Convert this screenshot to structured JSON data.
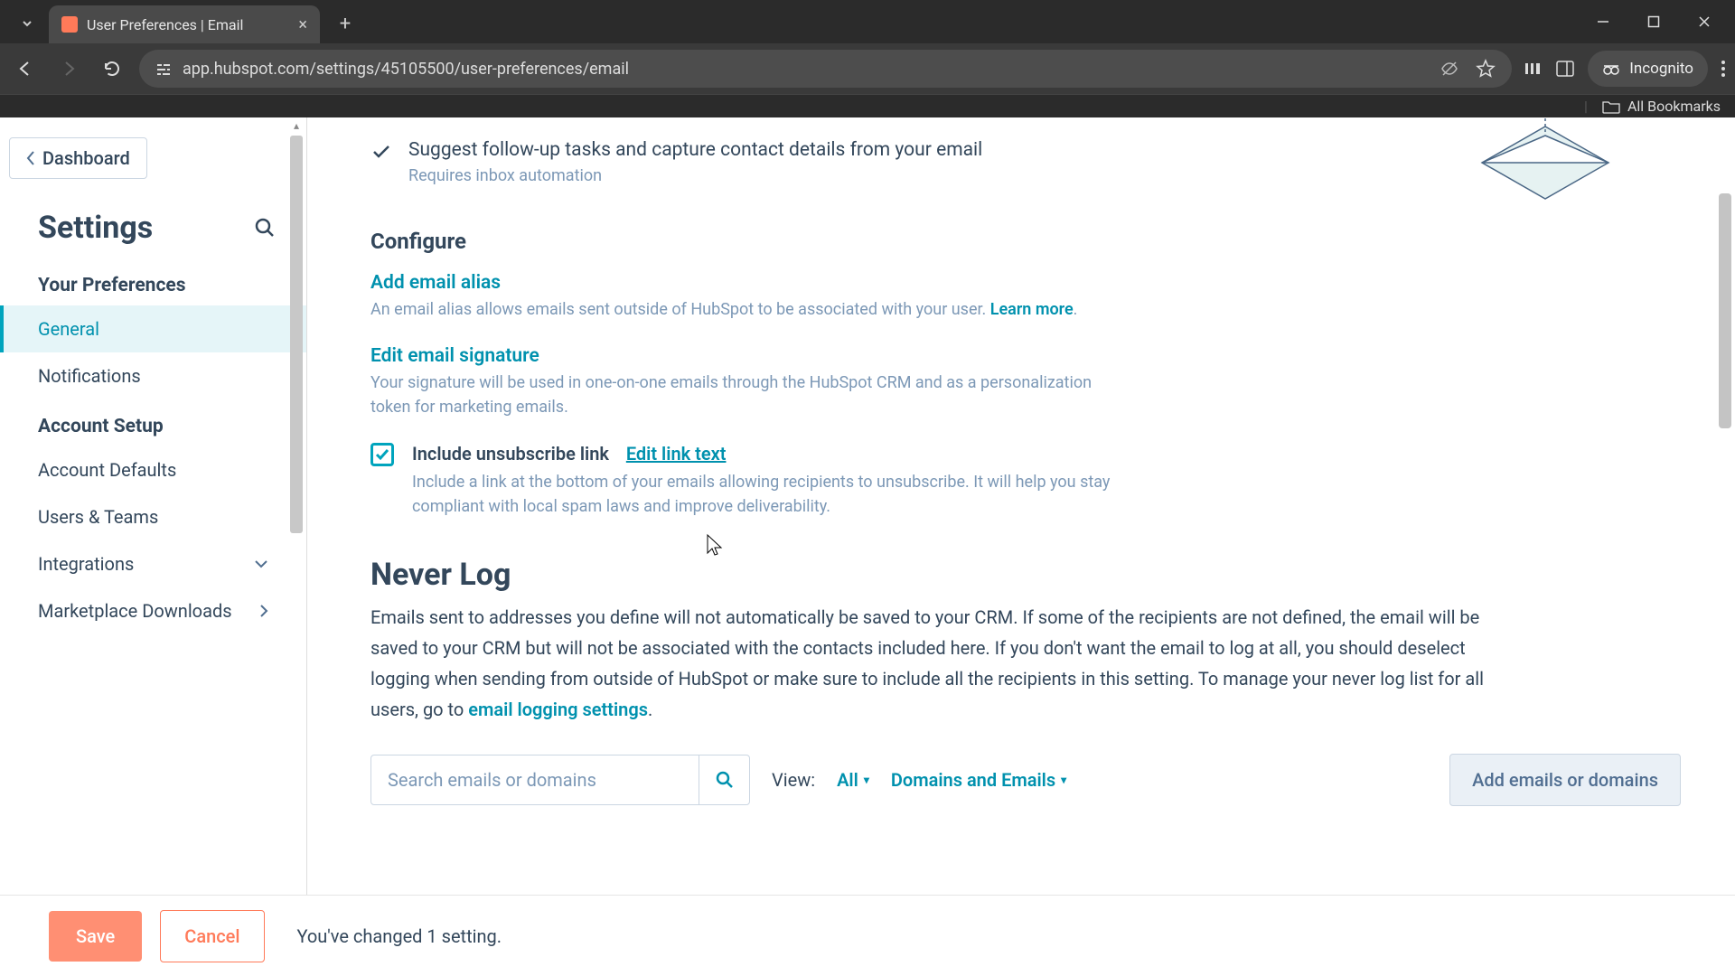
{
  "browser": {
    "tab_title": "User Preferences | Email",
    "url": "app.hubspot.com/settings/45105500/user-preferences/email",
    "incognito_label": "Incognito",
    "all_bookmarks": "All Bookmarks"
  },
  "sidebar": {
    "back_label": "Dashboard",
    "title": "Settings",
    "sections": [
      {
        "title": "Your Preferences",
        "items": [
          {
            "label": "General",
            "active": true
          },
          {
            "label": "Notifications"
          }
        ]
      },
      {
        "title": "Account Setup",
        "items": [
          {
            "label": "Account Defaults"
          },
          {
            "label": "Users & Teams"
          },
          {
            "label": "Integrations",
            "expandable": true
          },
          {
            "label": "Marketplace Downloads",
            "expandable": true
          }
        ]
      }
    ]
  },
  "content": {
    "feature": {
      "text": "Suggest follow-up tasks and capture contact details from your email",
      "sub": "Requires inbox automation"
    },
    "configure_heading": "Configure",
    "alias": {
      "link": "Add email alias",
      "desc_a": "An email alias allows emails sent outside of HubSpot to be associated with your user. ",
      "learn_more": "Learn more"
    },
    "signature": {
      "link": "Edit email signature",
      "desc": "Your signature will be used in one-on-one emails through the HubSpot CRM and as a personalization token for marketing emails."
    },
    "unsubscribe": {
      "label": "Include unsubscribe link",
      "edit_link": "Edit link text",
      "desc": "Include a link at the bottom of your emails allowing recipients to unsubscribe. It will help you stay compliant with local spam laws and improve deliverability."
    },
    "never_log": {
      "heading": "Never Log",
      "desc_a": "Emails sent to addresses you define will not automatically be saved to your CRM. If some of the recipients are not defined, the email will be saved to your CRM but will not be associated with the contacts included here. If you don't want the email to log at all, you should deselect logging when sending from outside of HubSpot or make sure to include all the recipients in this setting. To manage your never log list for all users, go to ",
      "link": "email logging settings",
      "period": "."
    },
    "search": {
      "placeholder": "Search emails or domains"
    },
    "view_label": "View:",
    "view_all": "All",
    "view_de": "Domains and Emails",
    "add_btn": "Add emails or domains"
  },
  "footer": {
    "save": "Save",
    "cancel": "Cancel",
    "changed": "You've changed 1 setting."
  }
}
